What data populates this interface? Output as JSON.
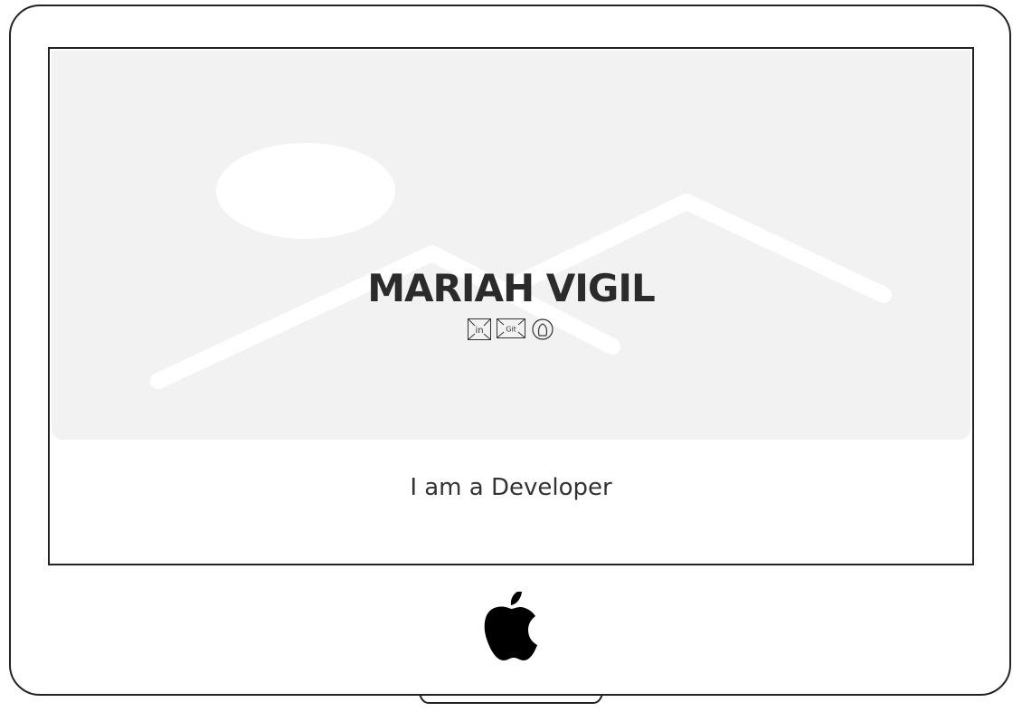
{
  "hero": {
    "name": "MARIAH VIGIL",
    "socials": [
      {
        "label": "in",
        "icon": "linkedin-icon"
      },
      {
        "label": "Git",
        "icon": "github-icon"
      },
      {
        "label": "",
        "icon": "profile-icon"
      }
    ]
  },
  "main": {
    "tagline": "I am a Developer"
  },
  "device": {
    "logo": "apple-logo-icon"
  },
  "colors": {
    "hero_bg": "#f2f2f2",
    "text": "#2b2b2b",
    "frame": "#222222"
  }
}
